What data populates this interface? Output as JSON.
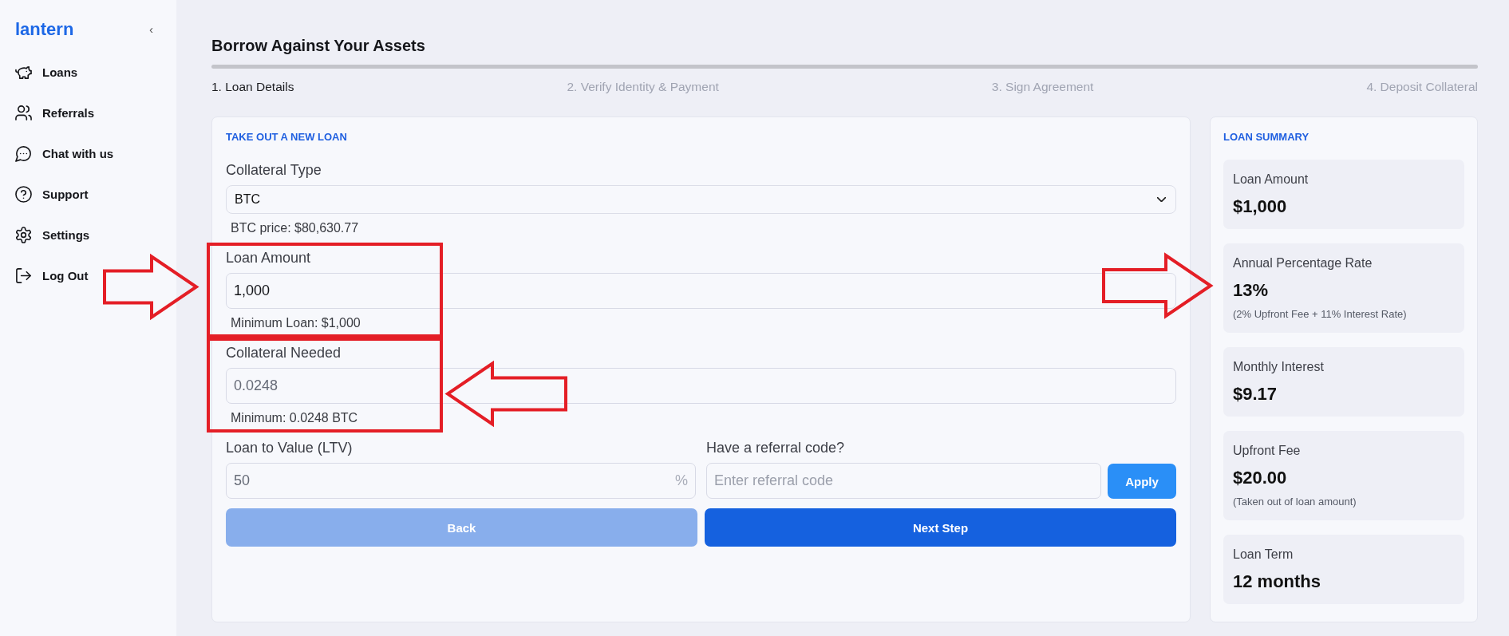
{
  "sidebar": {
    "logo": "lantern",
    "collapse_button": "‹",
    "items": [
      {
        "kind": "loans",
        "label": "Loans"
      },
      {
        "kind": "referrals",
        "label": "Referrals"
      },
      {
        "kind": "chat",
        "label": "Chat with us"
      },
      {
        "kind": "support",
        "label": "Support"
      },
      {
        "kind": "settings",
        "label": "Settings"
      },
      {
        "kind": "logout",
        "label": "Log Out"
      }
    ]
  },
  "page": {
    "title": "Borrow Against Your Assets",
    "steps": [
      {
        "label": "1. Loan Details",
        "selected": true
      },
      {
        "label": "2. Verify Identity & Payment",
        "selected": false
      },
      {
        "label": "3. Sign Agreement",
        "selected": false
      },
      {
        "label": "4. Deposit Collateral",
        "selected": false
      }
    ]
  },
  "form": {
    "heading": "TAKE OUT A NEW LOAN",
    "fields": [
      {
        "kind": "select",
        "label": "Collateral Type",
        "value": "BTC",
        "disabled": false,
        "hint": "BTC price: $80,630.77"
      },
      {
        "kind": "input",
        "label": "Loan Amount",
        "value": "1,000",
        "disabled": false,
        "hint": "Minimum Loan: $1,000",
        "annotation": {
          "kind": "box_arrow_from_left"
        }
      },
      {
        "kind": "input",
        "label": "Collateral Needed",
        "value": "0.0248",
        "disabled": true,
        "hint": "Minimum: 0.0248 BTC",
        "annotation": {
          "kind": "box_arrow_from_right"
        }
      }
    ],
    "ltv": {
      "label": "Loan to Value (LTV)",
      "value": "50",
      "suffix": "%",
      "disabled": true
    },
    "referral": {
      "label": "Have a referral code?",
      "placeholder": "Enter referral code",
      "button": "Apply"
    },
    "buttons": [
      {
        "label": "Back",
        "disabled": true
      },
      {
        "label": "Next Step",
        "disabled": false
      }
    ]
  },
  "summary": {
    "heading": "LOAN SUMMARY",
    "items": [
      {
        "label": "Loan Amount",
        "value": "$1,000"
      },
      {
        "label": "Annual Percentage Rate",
        "value": "13%",
        "note": "(2% Upfront Fee + 11% Interest Rate)",
        "annotation": {
          "kind": "arrow_from_left"
        }
      },
      {
        "label": "Monthly Interest",
        "value": "$9.17"
      },
      {
        "label": "Upfront Fee",
        "value": "$20.00",
        "note": "(Taken out of loan amount)"
      },
      {
        "label": "Loan Term",
        "value": "12 months"
      }
    ]
  }
}
